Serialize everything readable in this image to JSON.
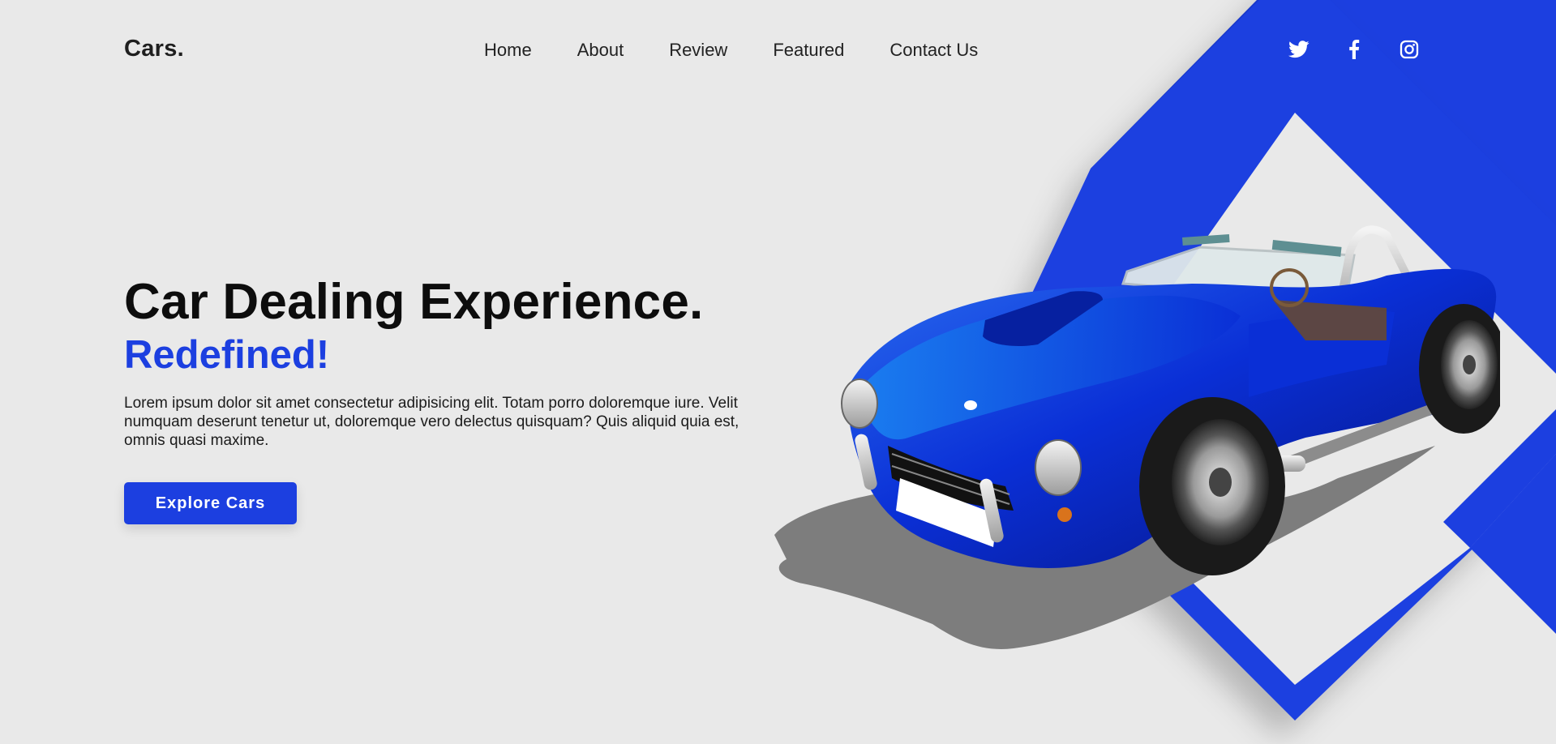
{
  "brand": {
    "logo": "Cars."
  },
  "nav": {
    "items": [
      {
        "label": "Home"
      },
      {
        "label": "About"
      },
      {
        "label": "Review"
      },
      {
        "label": "Featured"
      },
      {
        "label": "Contact Us"
      }
    ]
  },
  "social": {
    "icons": [
      "twitter-icon",
      "facebook-icon",
      "instagram-icon"
    ]
  },
  "hero": {
    "title": "Car Dealing Experience.",
    "subtitle": "Redefined!",
    "description": "Lorem ipsum dolor sit amet consectetur adipisicing elit. Totam porro doloremque iure. Velit numquam deserunt tenetur ut, doloremque vero delectus quisquam? Quis aliquid quia est, omnis quasi maxime.",
    "cta_label": "Explore Cars"
  },
  "colors": {
    "accent": "#1c3fe0",
    "background": "#e9e9e9",
    "text": "#111111"
  }
}
